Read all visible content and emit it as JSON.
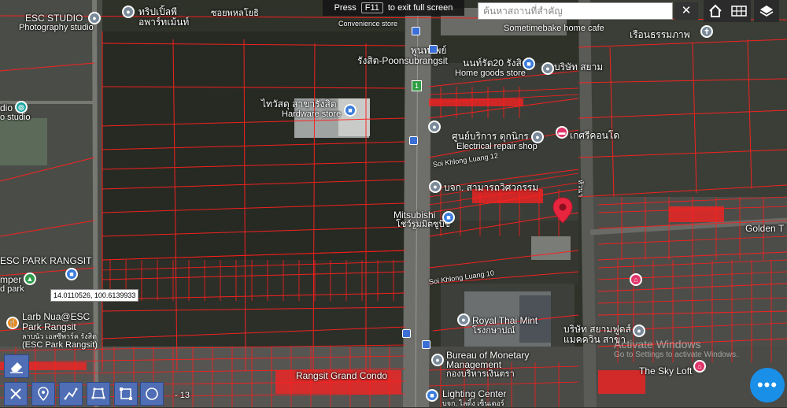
{
  "fullscreen_banner": {
    "press": "Press",
    "key": "F11",
    "rest": "to exit full screen"
  },
  "search": {
    "placeholder": "ค้นหาสถานที่สำคัญ",
    "clear": "✕"
  },
  "coordinate_tooltip": "14.0110526, 100.6139933",
  "watermark": {
    "line1": "Activate Windows",
    "line2": "Go to Settings to activate Windows."
  },
  "more_button": "•••",
  "colors": {
    "parcel_line": "#ff2020",
    "tool_blue": "#4f6eb5",
    "fab_blue": "#1a8fe8",
    "target_pin": "#e8253f"
  },
  "labels": {
    "esc_studio": "ESC STUDIO",
    "photography_studio": "Photography studio",
    "trip_pet": "ทริปเปิ้ลพี",
    "apartment": "อพาร์ทเม้นท์",
    "soi_phaholyothin": "ซอยพหลโยธิ",
    "convenience": "Convenience store",
    "pun_sub": "พูนทรัพย์",
    "rangsit_poonsub": "รังสิต-Poonsubrangsit",
    "nonrut": "นนท์รัต20 รังสิต",
    "home_goods": "Home goods store",
    "company_siam": "บริษัท สยาม",
    "sometime_cafe": "Sometimebake home cafe",
    "ruan_thong": "เรือนธรรมภาพ",
    "thaiwatsadu": "ไทวัสดุ สาขารังสิต",
    "hardware_store": "Hardware store",
    "service_center": "ศูนย์บริการ ดุกนิกร",
    "electrical_repair": "Electrical repair shop",
    "kaset": "เกศรีคอนโด",
    "soi_khlong12": "Soi Khlong Luang 12",
    "company_samart": "บจก. สามารถวิศวกรรม",
    "mitsubishi": "Mitsubishi",
    "mitsu_th": "โชว์รูมมิตซูบิชิ",
    "golden_town": "Golden T",
    "esc_park": "ESC PARK RANGSIT",
    "camper": "mper",
    "park": "d park",
    "soi_khlong10": "Soi Khlong Luang 10",
    "royal_mint": "Royal Thai Mint",
    "royal_mint_th": "โรงกษาปณ์",
    "larb_nua1": "Larb Nua@ESC",
    "larb_nua2": "Park Rangsit",
    "larb_nua3": "ลาบนัว เอสซีพาร์ค รังสิต",
    "larb_nua4": "(ESC Park Rangsit)",
    "company_siam2": "บริษัท สยามฟูดส์",
    "company_siam3": "แมคควิน สาขา",
    "bureau1": "Bureau of Monetary",
    "bureau2": "Management",
    "bureau_th": "กองบริหารเงินตรา",
    "rangsit_grand": "Rangsit Grand Condo",
    "sky_loft": "The Sky Loft",
    "lighting_center": "Lighting Center",
    "lighting_th": "บจก. ไลติ้ง เซ็นเตอร์",
    "road_vertical": "หัวนา",
    "studio_left": "dio",
    "studio_left2": "o studio",
    "road_13": "- 13",
    "route_badge": "1"
  }
}
